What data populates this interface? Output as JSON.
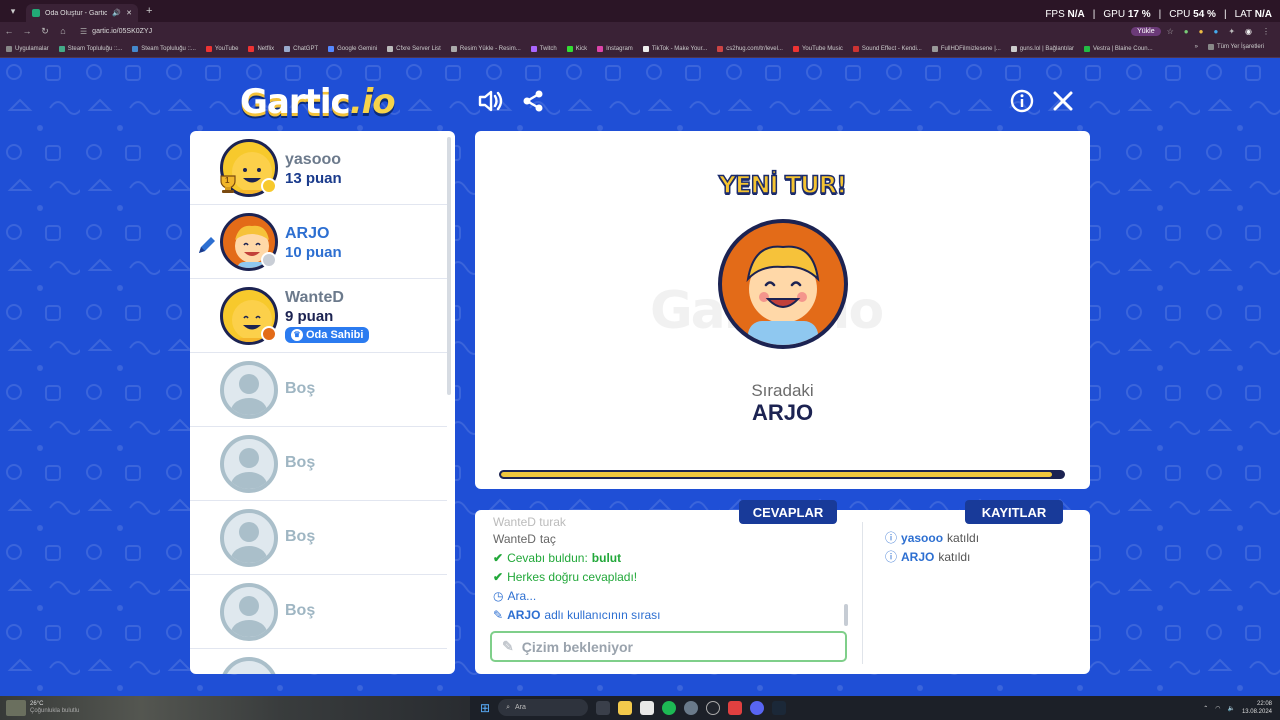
{
  "browser": {
    "tab_title": "Oda Oluştur - Gartic.io",
    "new_tab": "+",
    "url": "gartic.io/05SK0ZYJ",
    "yukle_label": "Yükle",
    "bookmarks": [
      "Uygulamalar",
      "Steam Topluluğu ::...",
      "Steam Topluluğu ::...",
      "YouTube",
      "Netflix",
      "ChatGPT",
      "Google Gemini",
      "Cfxre Server List",
      "Resim Yükle - Resim...",
      "Twitch",
      "Kick",
      "Instagram",
      "TikTok - Make Your...",
      "cs2hug.com/tr/level...",
      "YouTube Music",
      "Sound Effect - Kendi...",
      "FullHDFilmizlesene |...",
      "guns.lol | Bağlantılar",
      "Vestra | Blaine Coun..."
    ],
    "all_bookmarks": "Tüm Yer İşaretleri"
  },
  "overlay": {
    "fps_label": "FPS",
    "fps_value": "N/A",
    "gpu_label": "GPU",
    "gpu_value": "17 %",
    "cpu_label": "CPU",
    "cpu_value": "54 %",
    "lat_label": "LAT",
    "lat_value": "N/A"
  },
  "game": {
    "logo_main": "Gartic",
    "logo_io": ".io",
    "players": [
      {
        "name": "yasooo",
        "score": "13 puan",
        "status_color": "#f7c92c",
        "trophy_label": "1"
      },
      {
        "name": "ARJO",
        "score": "10 puan",
        "status_color": "#c9ced6",
        "drawing": true
      },
      {
        "name": "WanteD",
        "score": "9 puan",
        "status_color": "#e36b18",
        "owner_badge": "Oda Sahibi"
      },
      {
        "name": "Boş"
      },
      {
        "name": "Boş"
      },
      {
        "name": "Boş"
      },
      {
        "name": "Boş"
      }
    ],
    "stage": {
      "heading": "YENİ TUR!",
      "next_label": "Sıradaki",
      "next_name": "ARJO",
      "ghost_logo": "Gartic.io",
      "progress": 0.98
    },
    "tabs": {
      "answers": "CEVAPLAR",
      "logs": "KAYITLAR"
    },
    "answers": {
      "faded_line": "WanteD turak",
      "line1_name": "WanteD",
      "line1_text": "taç",
      "line2_text": "Cevabı buldun:",
      "line2_word": "bulut",
      "line3_text": "Herkes doğru cevapladı!",
      "line4_text": "Ara...",
      "line5_name": "ARJO",
      "line5_text": "adlı kullanıcının sırası"
    },
    "input_placeholder": "Çizim bekleniyor",
    "logs": [
      {
        "name": "yasooo",
        "text": "katıldı"
      },
      {
        "name": "ARJO",
        "text": "katıldı"
      }
    ]
  },
  "taskbar": {
    "search_label": "Ara",
    "weather_text": "26°C",
    "weather_sub": "Çoğunlukla bulutlu",
    "time": "22:08",
    "date": "13.08.2024"
  },
  "colors": {
    "bg_blue": "#1f4fd6",
    "dark_navy": "#183a99",
    "accent_yellow": "#f5c431",
    "success_green": "#22a83a"
  }
}
